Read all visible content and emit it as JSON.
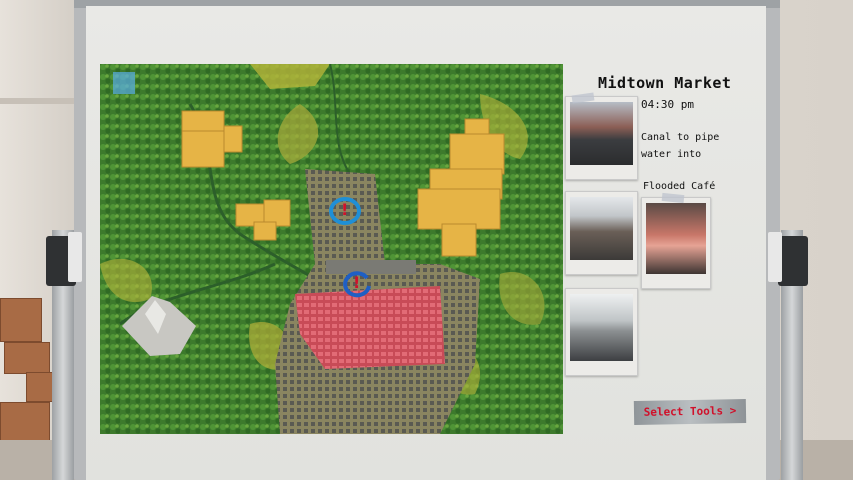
{
  "board": {
    "title": "Midtown Market",
    "time": "04:30 pm",
    "notes": {
      "canal": [
        "Canal to pipe",
        "water into"
      ],
      "flooded": "Flooded Café"
    },
    "select_tools_label": "Select Tools >"
  },
  "map": {
    "quest_markers": [
      {
        "name": "quest-marker-north",
        "glyph": "!"
      },
      {
        "name": "quest-marker-market",
        "glyph": "!"
      }
    ]
  },
  "colors": {
    "accent_red": "#d0112b",
    "marker_blue": "#1f8fd6",
    "zone_yellow": "#e6b446",
    "zone_red": "#e0606b",
    "forest": "#3f7f2e"
  },
  "icons": {
    "map_corner": "map-grid-icon",
    "quest": "exclamation-icon"
  }
}
